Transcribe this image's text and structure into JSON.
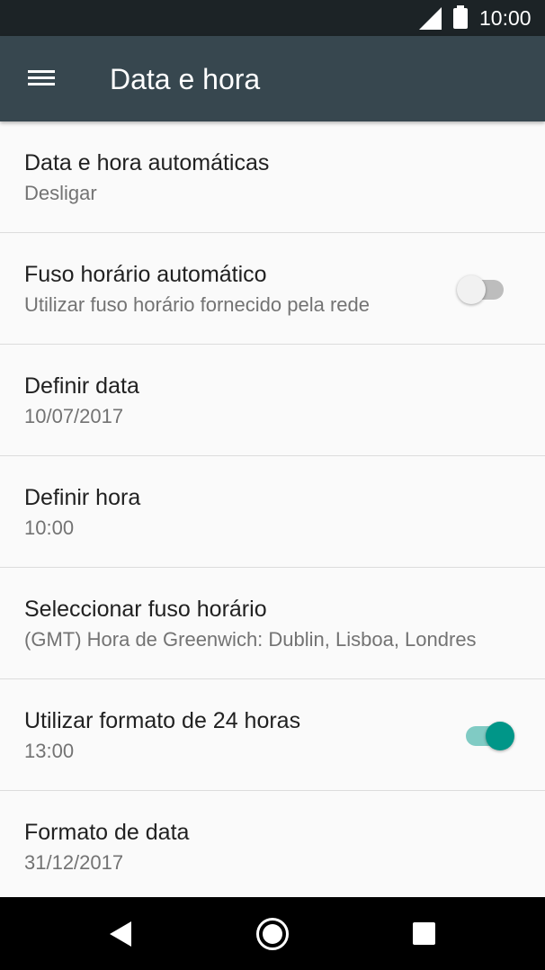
{
  "status_bar": {
    "time": "10:00",
    "icons": [
      "signal-icon",
      "battery-icon"
    ]
  },
  "app_bar": {
    "title": "Data e hora",
    "menu_icon": "hamburger-menu-icon"
  },
  "settings": [
    {
      "title": "Data e hora automáticas",
      "summary": "Desligar"
    },
    {
      "title": "Fuso horário automático",
      "summary": "Utilizar fuso horário fornecido pela rede",
      "switch": "off"
    },
    {
      "title": "Definir data",
      "summary": "10/07/2017"
    },
    {
      "title": "Definir hora",
      "summary": "10:00"
    },
    {
      "title": "Seleccionar fuso horário",
      "summary": "(GMT) Hora de Greenwich: Dublin, Lisboa, Londres"
    },
    {
      "title": "Utilizar formato de 24 horas",
      "summary": "13:00",
      "switch": "on"
    },
    {
      "title": "Formato de data",
      "summary": "31/12/2017"
    }
  ],
  "colors": {
    "app_bar": "#37474f",
    "status_bar": "#1c2326",
    "accent": "#009688",
    "accent_track": "#80cbc4",
    "background": "#fafafa"
  },
  "nav_bar": {
    "icons": [
      "back-icon",
      "home-icon",
      "recents-icon"
    ]
  }
}
